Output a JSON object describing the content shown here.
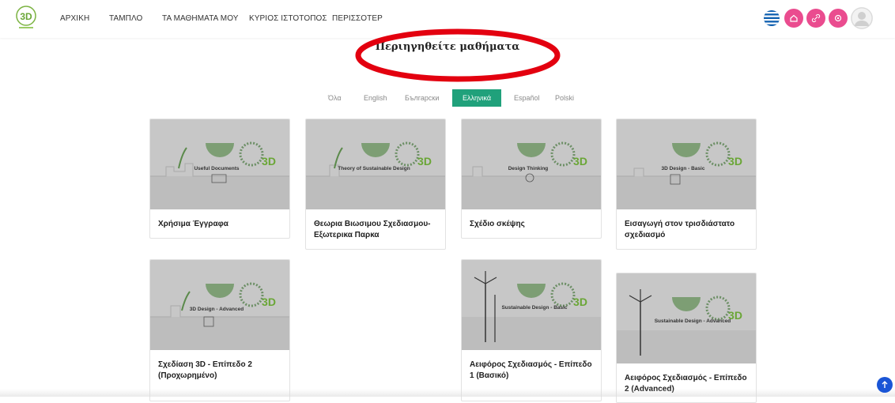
{
  "nav": {
    "items": [
      "ΑΡΧΙΚΗ",
      "ΤΑΜΠΛΟ",
      "ΤΑ ΜΑΘΗΜΑΤΑ ΜΟΥ",
      "ΚΥΡΙΟΣ ΙΣΤΟΤΟΠΟΣ",
      "ΠΕΡΙΣΣΟΤΕΡ"
    ],
    "logo_text": "3D",
    "right_icons": [
      "greece-flag-icon",
      "home-icon",
      "link-icon",
      "settings-icon",
      "user-avatar"
    ]
  },
  "page": {
    "title": "Περιηγηθείτε μαθήματα"
  },
  "language_tabs": {
    "items": [
      "Όλα",
      "English",
      "Български",
      "Ελληνικά",
      "Español",
      "Polski"
    ],
    "active": "Ελληνικά"
  },
  "courses": [
    {
      "banner_label": "Useful Documents",
      "title": "Χρήσιμα Έγγραφα"
    },
    {
      "banner_label": "Theory of Sustainable Design",
      "title": "Θεωρια Βιωσιμου Σχεδιασμου- Εξωτερικα Παρκα"
    },
    {
      "banner_label": "Design Thinking",
      "title": "Σχέδιο σκέψης"
    },
    {
      "banner_label": "3D Design - Basic",
      "title": "Εισαγωγή στον τρισδιάστατο σχεδιασμό"
    },
    {
      "banner_label": "3D Design - Advanced",
      "title": "Σχεδίαση 3D - Επίπεδο 2 (Προχωρημένο)"
    },
    {
      "banner_label": "Sustainable Design - Basic",
      "title": "Αειφόρος Σχεδιασμός - Επίπεδο 1 (Βασικό)"
    },
    {
      "banner_label": "Sustainable Design - Advanced",
      "title": "Αειφόρος Σχεδιασμός - Επίπεδο 2 (Advanced)"
    }
  ],
  "colors": {
    "accent_green": "#20a17b",
    "icon_pink": "#ea4c8f",
    "annotation_red": "#e3000f",
    "scroll_blue": "#1a55d6",
    "banner_gray": "#c7c7c7"
  }
}
